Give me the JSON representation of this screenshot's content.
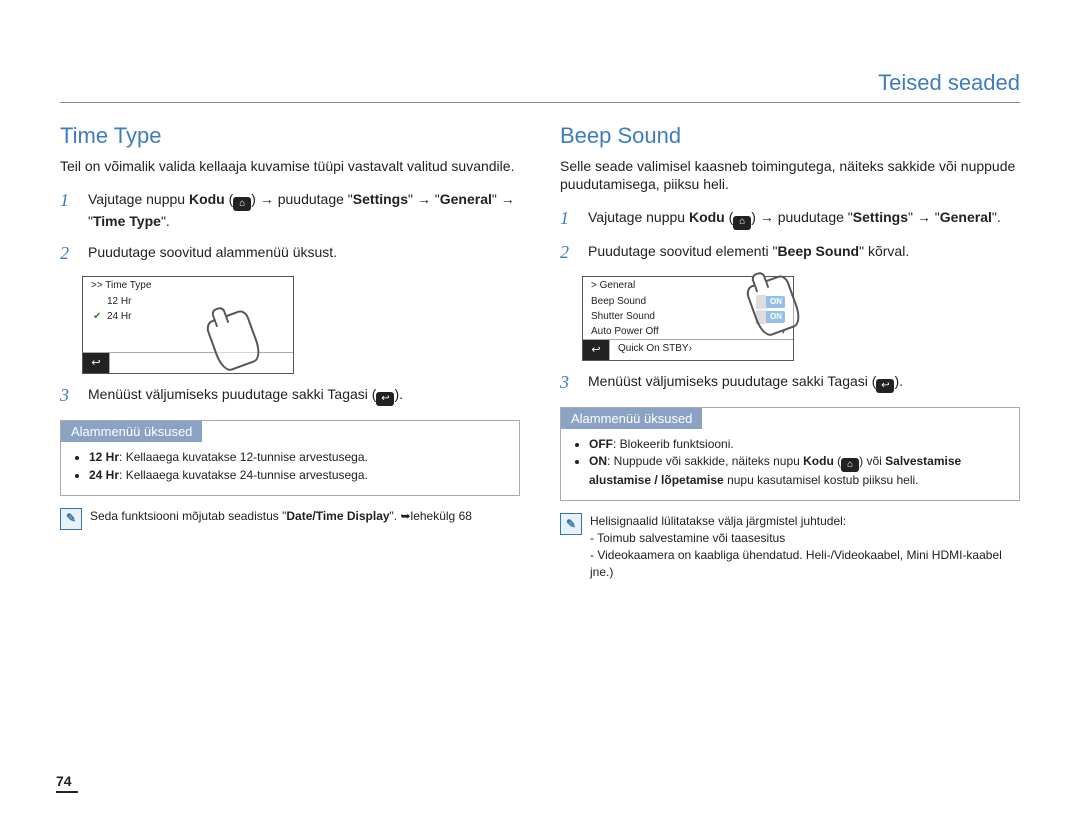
{
  "chapter_title": "Teised seaded",
  "page_number": "74",
  "left": {
    "title": "Time Type",
    "intro": "Teil on võimalik valida kellaaja kuvamise tüüpi vastavalt valitud suvandile.",
    "step1_pre": "Vajutage nuppu ",
    "kodu": "Kodu",
    "step1_mid1": " → puudutage \"",
    "settings": "Settings",
    "step1_mid2": "\" → \"",
    "general": "General",
    "step1_mid3": "\" → \"",
    "timetype": "Time Type",
    "step1_end": "\".",
    "step2": "Puudutage soovitud alammenüü üksust.",
    "step3_pre": "Menüüst väljumiseks puudutage sakki Tagasi (",
    "step3_post": ").",
    "screen": {
      "header": ">> Time Type",
      "item1": "12 Hr",
      "item2": "24 Hr"
    },
    "submenu_title": "Alammenüü üksused",
    "submenu_1_lbl": "12 Hr",
    "submenu_1_txt": ": Kellaaega kuvatakse 12-tunnise arvestusega.",
    "submenu_2_lbl": "24 Hr",
    "submenu_2_txt": ": Kellaaega kuvatakse 24-tunnise arvestusega.",
    "note_pre": "Seda funktsiooni mõjutab seadistus \"",
    "note_b": "Date/Time Display",
    "note_post": "\". ➥lehekülg 68"
  },
  "right": {
    "title": "Beep Sound",
    "intro": "Selle seade valimisel kaasneb toimingutega, näiteks sakkide või nuppude puudutamisega, piiksu heli.",
    "step1_pre": "Vajutage nuppu ",
    "kodu": "Kodu",
    "step1_mid1": " → puudutage \"",
    "settings": "Settings",
    "step1_mid2": "\" → \"",
    "general": "General",
    "step1_end": "\".",
    "step2_pre": "Puudutage soovitud elementi \"",
    "step2_b": "Beep Sound",
    "step2_post": "\" kõrval.",
    "step3_pre": "Menüüst väljumiseks puudutage sakki Tagasi (",
    "step3_post": ").",
    "screen": {
      "header": "> General",
      "r1": "Beep Sound",
      "r1v": "ON",
      "r2": "Shutter Sound",
      "r2v": "ON",
      "r3": "Auto Power Off",
      "r4": "Quick On STBY"
    },
    "submenu_title": "Alammenüü üksused",
    "submenu_1_lbl": "OFF",
    "submenu_1_txt": ": Blokeerib funktsiooni.",
    "submenu_2_lbl": "ON",
    "submenu_2_txt_a": ": Nuppude või sakkide, näiteks nupu ",
    "submenu_2_kodu": "Kodu",
    "submenu_2_txt_b": " või ",
    "submenu_2_b2": "Salvestamise alustamise / lõpetamise",
    "submenu_2_txt_c": " nupu kasutamisel kostub piiksu heli.",
    "note_l1": "Helisignaalid lülitatakse välja järgmistel juhtudel:",
    "note_l2": "- Toimub salvestamine või taasesitus",
    "note_l3": "- Videokaamera on kaabliga ühendatud. Heli-/Videokaabel, Mini HDMI-kaabel jne.)"
  }
}
